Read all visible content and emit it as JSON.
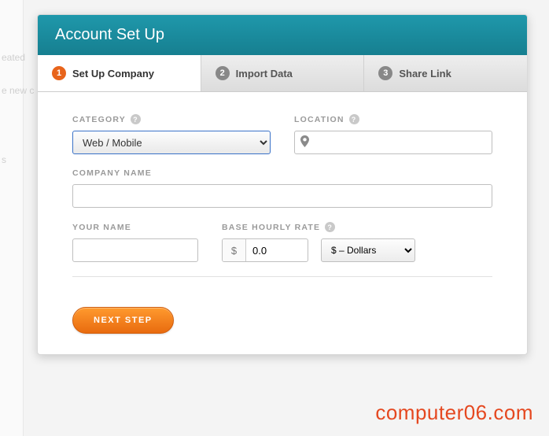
{
  "background": {
    "ghost1": "eated",
    "ghost2": "e new c",
    "ghost3": "s"
  },
  "header": {
    "title": "Account Set Up"
  },
  "tabs": [
    {
      "num": "1",
      "label": "Set Up Company",
      "active": true
    },
    {
      "num": "2",
      "label": "Import Data",
      "active": false
    },
    {
      "num": "3",
      "label": "Share Link",
      "active": false
    }
  ],
  "form": {
    "category": {
      "label": "CATEGORY",
      "value": "Web / Mobile",
      "options": [
        "Web / Mobile"
      ]
    },
    "location": {
      "label": "LOCATION",
      "value": ""
    },
    "company_name": {
      "label": "COMPANY NAME",
      "value": ""
    },
    "your_name": {
      "label": "YOUR NAME",
      "value": ""
    },
    "rate": {
      "label": "BASE HOURLY RATE",
      "prefix": "$",
      "value": "0.0",
      "currency_value": "$ – Dollars",
      "currency_options": [
        "$ – Dollars"
      ]
    }
  },
  "footer": {
    "next_label": "NEXT STEP"
  },
  "watermark": "computer06.com"
}
